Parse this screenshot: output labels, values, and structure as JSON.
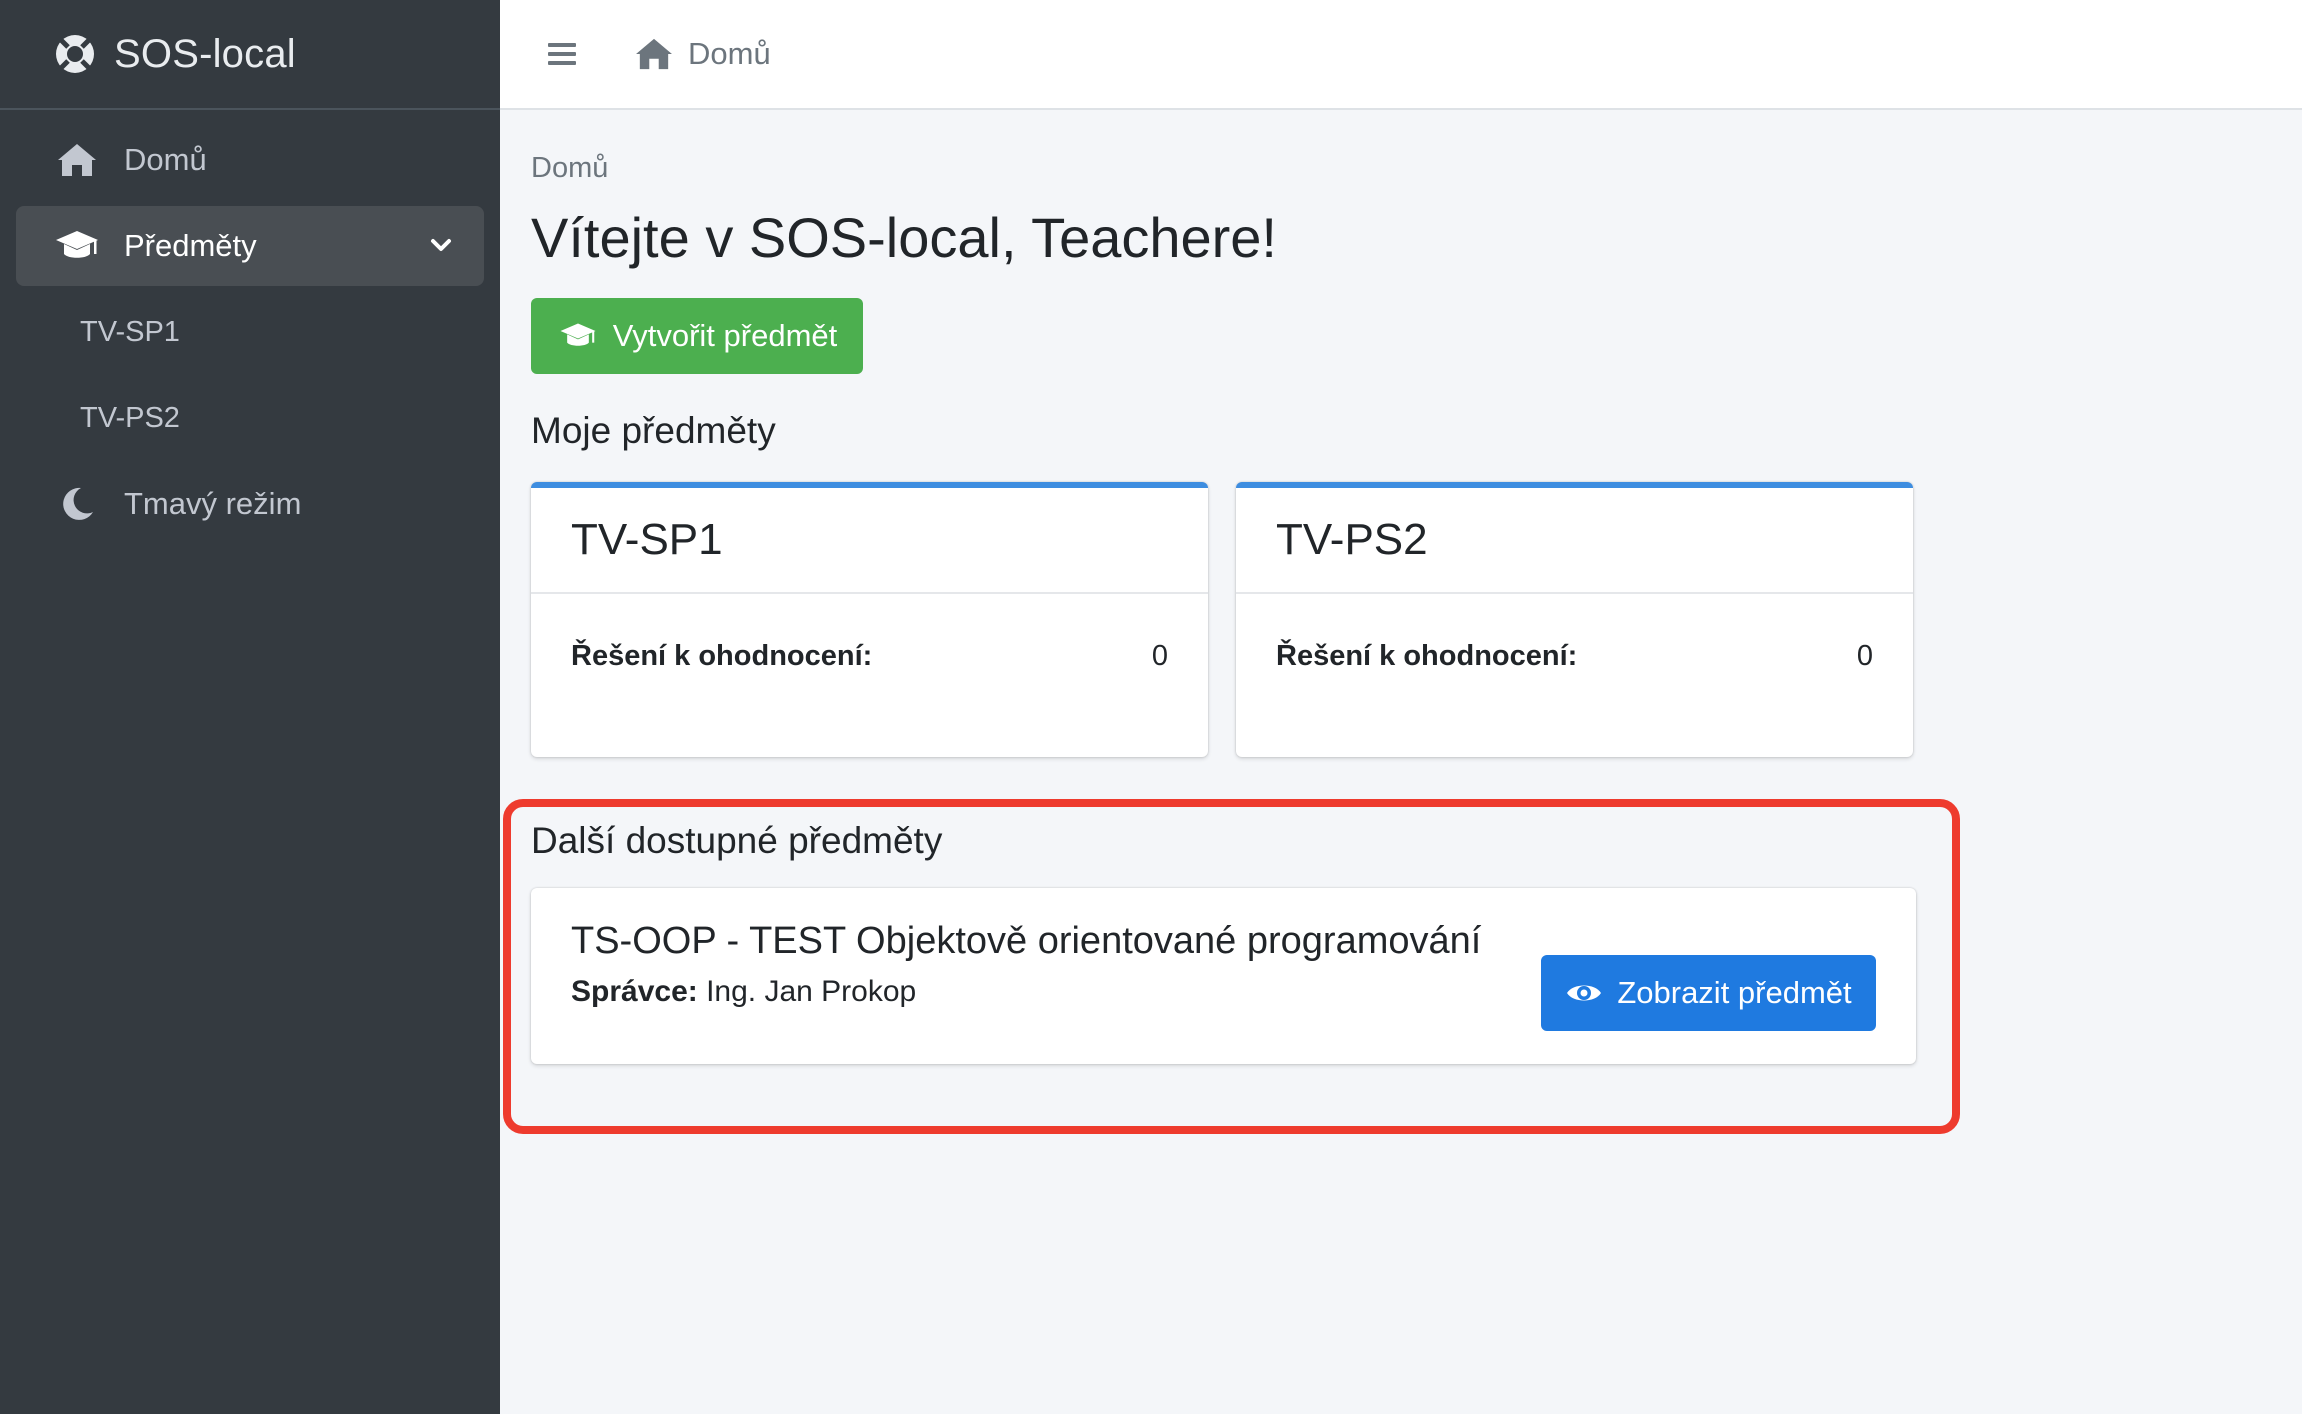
{
  "app": {
    "brand": "SOS-local"
  },
  "sidebar": {
    "items": [
      {
        "label": "Domů",
        "icon": "home-icon"
      },
      {
        "label": "Předměty",
        "icon": "graduation-cap-icon",
        "active": true
      },
      {
        "label": "TV-SP1"
      },
      {
        "label": "TV-PS2"
      },
      {
        "label": "Tmavý režim",
        "icon": "moon-icon"
      }
    ]
  },
  "topbar": {
    "home_label": "Domů"
  },
  "main": {
    "breadcrumb": "Domů",
    "title": "Vítejte v SOS-local, Teachere!",
    "create_button": "Vytvořit předmět",
    "my_subjects_title": "Moje předměty",
    "my_subjects": [
      {
        "name": "TV-SP1",
        "label": "Řešení k ohodnocení:",
        "count": "0"
      },
      {
        "name": "TV-PS2",
        "label": "Řešení k ohodnocení:",
        "count": "0"
      }
    ],
    "other_subjects_title": "Další dostupné předměty",
    "other_subjects": [
      {
        "name": "TS-OOP - TEST Objektově orientované programování",
        "admin_label": "Správce:",
        "admin_name": " Ing. Jan Prokop",
        "button": "Zobrazit předmět"
      }
    ]
  },
  "colors": {
    "sidebar_bg": "#343a40",
    "success": "#4caf4f",
    "primary": "#1f7ae0",
    "card_accent": "#3d8de0",
    "highlight": "#ee3b2e"
  }
}
